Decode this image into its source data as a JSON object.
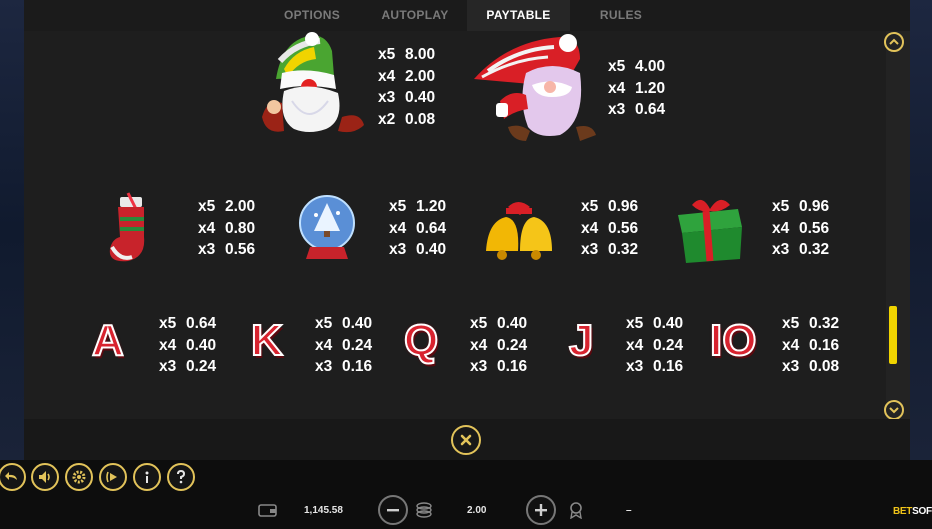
{
  "tabs": [
    {
      "label": "OPTIONS",
      "active": false
    },
    {
      "label": "AUTOPLAY",
      "active": false
    },
    {
      "label": "PAYTABLE",
      "active": true
    },
    {
      "label": "RULES",
      "active": false
    }
  ],
  "paytable": {
    "gnome_green": {
      "symbol": "green-hat-gnome",
      "pays": [
        [
          "x5",
          "8.00"
        ],
        [
          "x4",
          "2.00"
        ],
        [
          "x3",
          "0.40"
        ],
        [
          "x2",
          "0.08"
        ]
      ]
    },
    "gnome_red": {
      "symbol": "red-hat-gnome",
      "pays": [
        [
          "x5",
          "4.00"
        ],
        [
          "x4",
          "1.20"
        ],
        [
          "x3",
          "0.64"
        ]
      ]
    },
    "stocking": {
      "symbol": "christmas-stocking",
      "pays": [
        [
          "x5",
          "2.00"
        ],
        [
          "x4",
          "0.80"
        ],
        [
          "x3",
          "0.56"
        ]
      ]
    },
    "snowglobe": {
      "symbol": "snow-globe",
      "pays": [
        [
          "x5",
          "1.20"
        ],
        [
          "x4",
          "0.64"
        ],
        [
          "x3",
          "0.40"
        ]
      ]
    },
    "bells": {
      "symbol": "bells",
      "pays": [
        [
          "x5",
          "0.96"
        ],
        [
          "x4",
          "0.56"
        ],
        [
          "x3",
          "0.32"
        ]
      ]
    },
    "gift": {
      "symbol": "gift-box",
      "pays": [
        [
          "x5",
          "0.96"
        ],
        [
          "x4",
          "0.56"
        ],
        [
          "x3",
          "0.32"
        ]
      ]
    },
    "A": {
      "symbol": "A",
      "pays": [
        [
          "x5",
          "0.64"
        ],
        [
          "x4",
          "0.40"
        ],
        [
          "x3",
          "0.24"
        ]
      ]
    },
    "K": {
      "symbol": "K",
      "pays": [
        [
          "x5",
          "0.40"
        ],
        [
          "x4",
          "0.24"
        ],
        [
          "x3",
          "0.16"
        ]
      ]
    },
    "Q": {
      "symbol": "Q",
      "pays": [
        [
          "x5",
          "0.40"
        ],
        [
          "x4",
          "0.24"
        ],
        [
          "x3",
          "0.16"
        ]
      ]
    },
    "J": {
      "symbol": "J",
      "pays": [
        [
          "x5",
          "0.40"
        ],
        [
          "x4",
          "0.24"
        ],
        [
          "x3",
          "0.16"
        ]
      ]
    },
    "ten": {
      "symbol": "IO",
      "pays": [
        [
          "x5",
          "0.32"
        ],
        [
          "x4",
          "0.16"
        ],
        [
          "x3",
          "0.08"
        ]
      ]
    }
  },
  "scrollbar": {
    "position_fraction": 0.88
  },
  "bottom": {
    "balance": "1,145.58",
    "bet": "2.00",
    "win": "–",
    "logo_bet": "BET",
    "logo_soft": "SOFT"
  },
  "colors": {
    "accent": "#e2c35a",
    "scroll_thumb": "#f0d400",
    "letter_red": "#d8232f"
  },
  "icons": {
    "back": "back-arrow-icon",
    "sound": "speaker-icon",
    "settings": "gear-icon",
    "autoplay": "autoplay-icon",
    "info": "info-icon",
    "help": "question-icon",
    "wallet": "wallet-icon",
    "coins": "coins-icon",
    "minus": "minus-icon",
    "plus": "plus-icon",
    "win": "trophy-icon",
    "close": "close-icon",
    "scroll_up": "chevron-up-icon",
    "scroll_down": "chevron-down-icon"
  }
}
